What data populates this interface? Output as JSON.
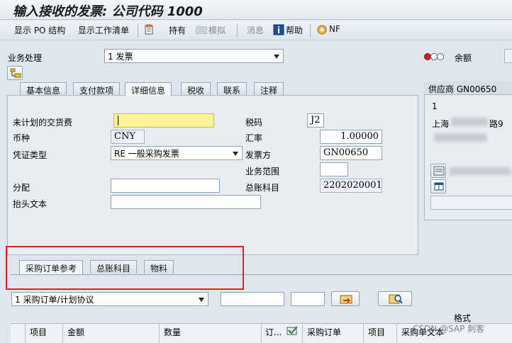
{
  "window": {
    "title": "输入接收的发票: 公司代码 1000"
  },
  "toolbar": {
    "show_po_structure": "显示 PO 结构",
    "show_worklist": "显示工作清单",
    "hold": "持有",
    "simulate": "模拟",
    "messages": "消息",
    "help": "帮助",
    "nf": "NF"
  },
  "top": {
    "transaction_label": "业务处理",
    "transaction_value": "1 发票",
    "balance_label": "余额"
  },
  "tabs": [
    {
      "label": "基本信息"
    },
    {
      "label": "支付款项"
    },
    {
      "label": "详细信息"
    },
    {
      "label": "税收"
    },
    {
      "label": "联系"
    },
    {
      "label": "注释"
    }
  ],
  "details": {
    "unplanned_delivery_cost_label": "未计划的交货费",
    "unplanned_delivery_cost_value": "",
    "currency_label": "币种",
    "currency_value": "CNY",
    "doc_type_label": "凭证类型",
    "doc_type_value": "RE 一般采购发票",
    "assignment_label": "分配",
    "assignment_value": "",
    "header_text_label": "抬头文本",
    "header_text_value": "",
    "tax_code_label": "税码",
    "tax_code_value": "J2",
    "exchange_rate_label": "汇率",
    "exchange_rate_value": "1.00000",
    "invoicing_party_label": "发票方",
    "invoicing_party_value": "GN00650",
    "business_area_label": "业务范围",
    "business_area_value": "",
    "gl_account_label": "总账科目",
    "gl_account_value": "2202020001"
  },
  "vendor": {
    "header": "供应商 GN00650",
    "line1": "1",
    "line2": "上海",
    "line2_suffix": "路9"
  },
  "subtabs": [
    {
      "label": "采购订单参考"
    },
    {
      "label": "总账科目"
    },
    {
      "label": "物料"
    }
  ],
  "reference": {
    "type_value": "1 采购订单/计划协议",
    "layout_label": "格式"
  },
  "table": {
    "columns": [
      "项目",
      "金额",
      "数量",
      "订...",
      "采购订单",
      "项目",
      "采购单文本"
    ]
  },
  "watermark": "CSDN @SAP 刺客",
  "colors": {
    "accent_yellow": "#fbf29a",
    "annotation_red": "#e22222"
  }
}
